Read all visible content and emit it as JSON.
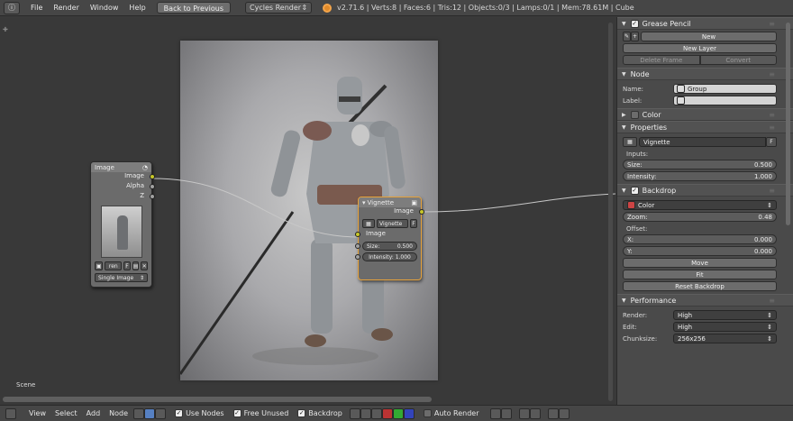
{
  "header": {
    "info_icon": "info-icon",
    "menus": [
      "File",
      "Render",
      "Window",
      "Help"
    ],
    "back_button": "Back to Previous",
    "engine": "Cycles Render",
    "stats": "v2.71.6 | Verts:8 | Faces:6 | Tris:12 | Objects:0/3 | Lamps:0/1 | Mem:78.61M | Cube"
  },
  "node_editor": {
    "image_node": {
      "title": "Image",
      "outputs": [
        "Image",
        "Alpha",
        "Z"
      ],
      "image_name": "ren",
      "f_label": "F",
      "source": "Single Image"
    },
    "vignette_node": {
      "title": "Vignette",
      "output": "Image",
      "group_name": "Vignette",
      "f_label": "F",
      "input_image": "Image",
      "size_label": "Size:",
      "size_value": "0.500",
      "intensity": "Intensity: 1.000"
    },
    "scene_label": "Scene"
  },
  "footer": {
    "menus": [
      "View",
      "Select",
      "Add",
      "Node"
    ],
    "use_nodes": "Use Nodes",
    "free_unused": "Free Unused",
    "backdrop": "Backdrop",
    "auto_render": "Auto Render"
  },
  "properties": {
    "grease_pencil": {
      "title": "Grease Pencil",
      "new_btn": "New",
      "new_layer_btn": "New Layer",
      "delete_frame_btn": "Delete Frame",
      "convert_btn": "Convert"
    },
    "node": {
      "title": "Node",
      "name_label": "Name:",
      "name_value": "Group",
      "label_label": "Label:",
      "label_value": ""
    },
    "color_title": "Color",
    "properties_panel": {
      "title": "Properties",
      "group_value": "Vignette",
      "f_label": "F",
      "inputs_label": "Inputs:",
      "size_label": "Size:",
      "size_value": "0.500",
      "intensity_label": "Intensity:",
      "intensity_value": "1.000"
    },
    "backdrop": {
      "title": "Backdrop",
      "channel": "Color",
      "zoom_label": "Zoom:",
      "zoom_value": "0.48",
      "offset_label": "Offset:",
      "x_label": "X:",
      "x_value": "0.000",
      "y_label": "Y:",
      "y_value": "0.000",
      "move_btn": "Move",
      "fit_btn": "Fit",
      "reset_btn": "Reset Backdrop"
    },
    "performance": {
      "title": "Performance",
      "render_label": "Render:",
      "render_value": "High",
      "edit_label": "Edit:",
      "edit_value": "High",
      "chunksize_label": "Chunksize:",
      "chunksize_value": "256x256"
    }
  },
  "colors": {
    "socket_image": "#c7c729",
    "socket_value": "#a1a1a1",
    "active_node_outline": "#e8a33a",
    "active_toggle": "#5680c2"
  }
}
